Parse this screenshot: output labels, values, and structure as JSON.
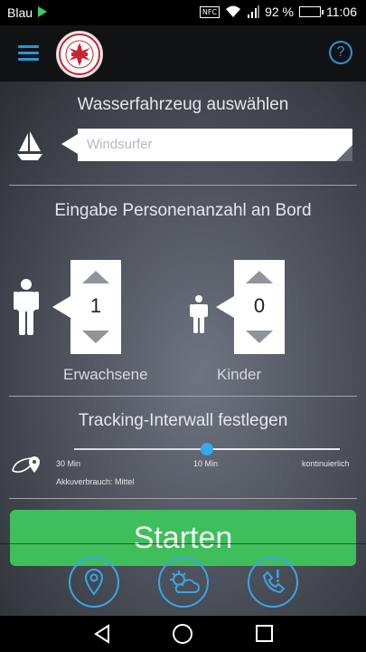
{
  "status_bar": {
    "carrier": "Blau",
    "nfc": "NFC",
    "battery_percent": "92 %",
    "time": "11:06",
    "battery_level": 0.92
  },
  "app_bar": {
    "help_label": "?"
  },
  "vessel": {
    "title": "Wasserfahrzeug auswählen",
    "placeholder": "Windsurfer"
  },
  "persons": {
    "title": "Eingabe Personenanzahl an Bord",
    "adults": {
      "label": "Erwachsene",
      "value": "1"
    },
    "children": {
      "label": "Kinder",
      "value": "0"
    }
  },
  "tracking": {
    "title": "Tracking-Interwall festlegen",
    "ticks": [
      "30 Min",
      "10 Min",
      "kontinuierlich"
    ],
    "selected_index": 1,
    "battery_usage": "Akkuverbrauch: Mittel"
  },
  "start_button": {
    "label": "Starten"
  },
  "colors": {
    "accent": "#2a95d6",
    "start": "#3fbf5c",
    "slider_thumb": "#36aaf0"
  },
  "icons": {
    "bottom_buttons": [
      "location-pin-icon",
      "weather-icon",
      "emergency-call-icon"
    ]
  }
}
